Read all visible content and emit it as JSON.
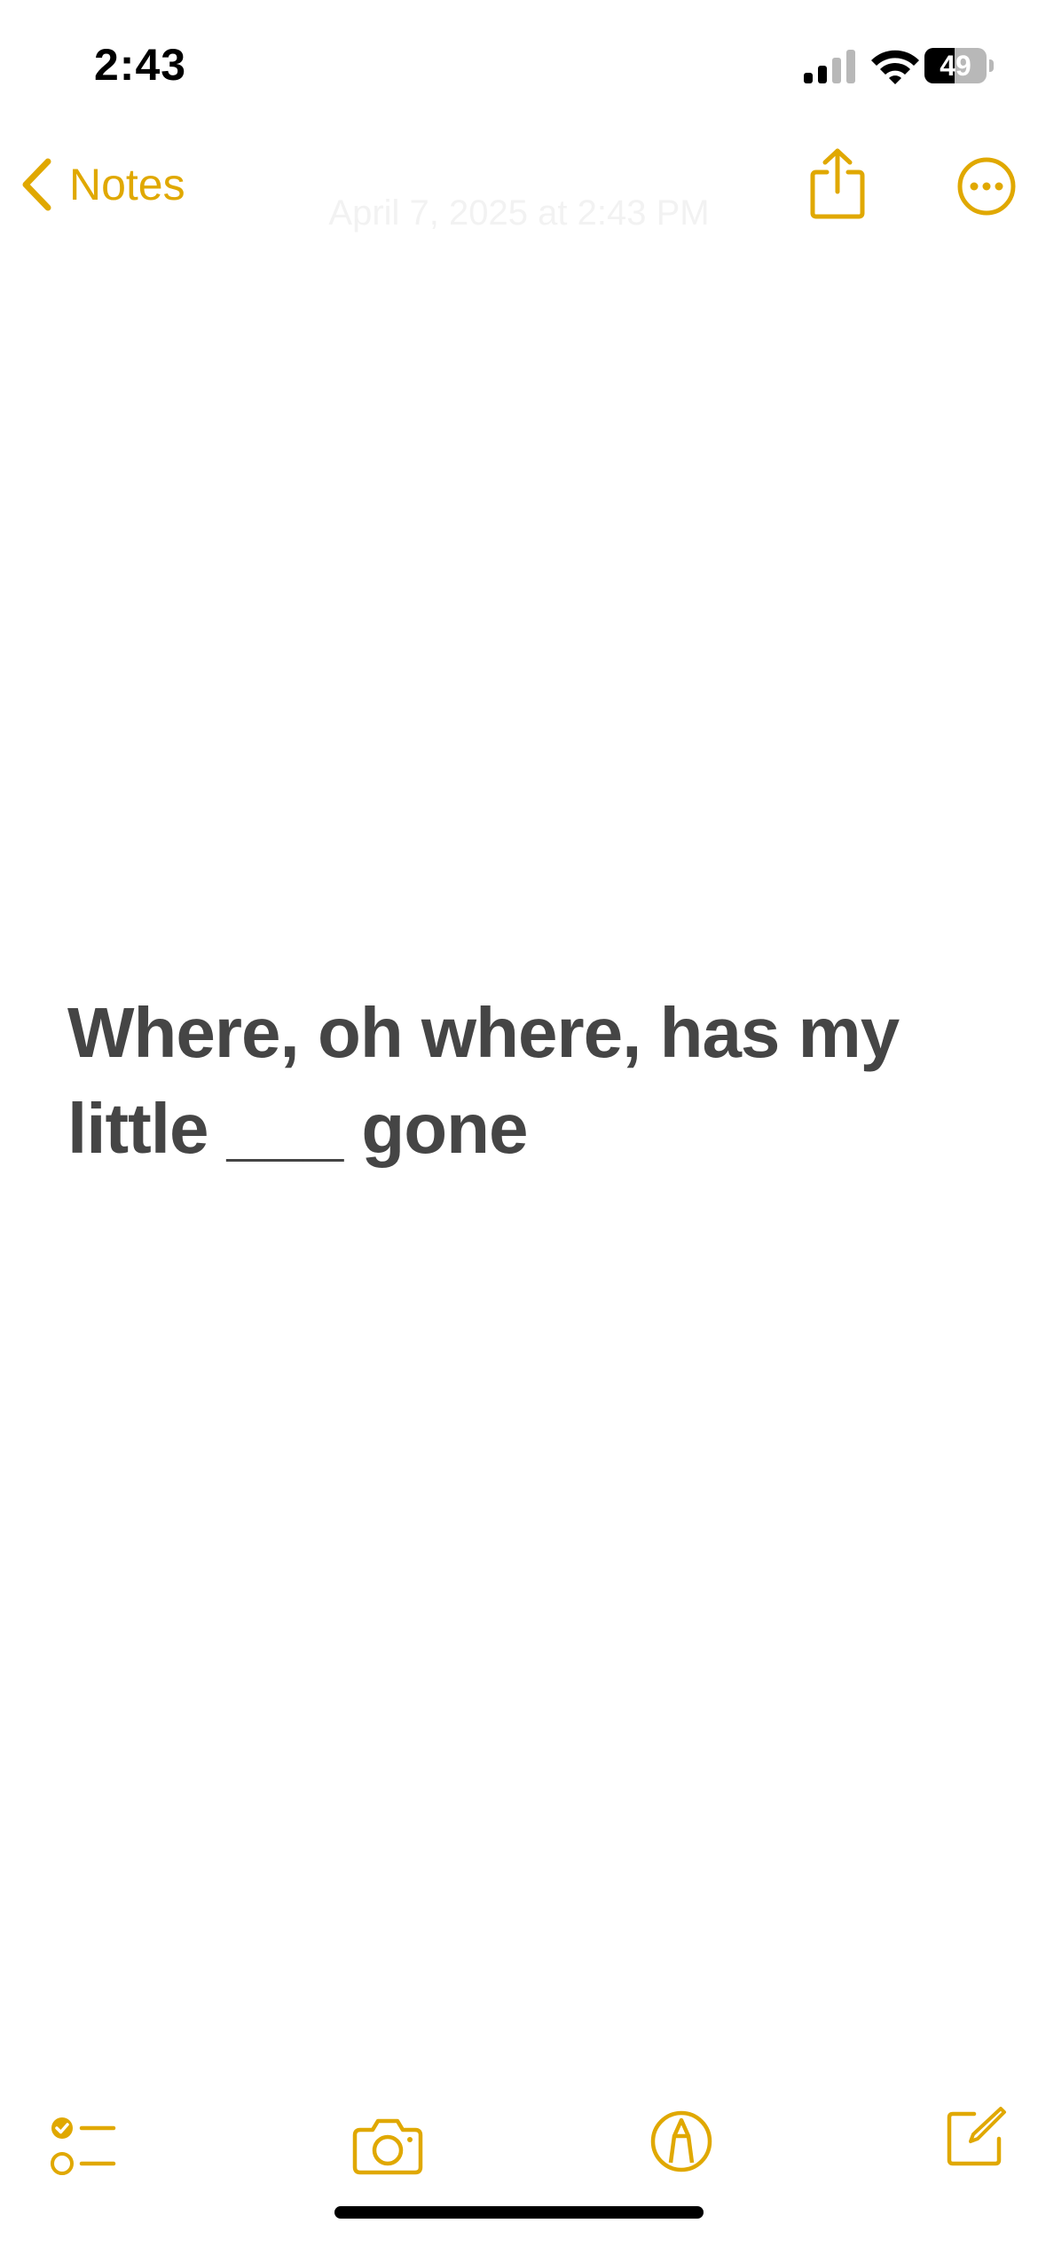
{
  "status_bar": {
    "time": "2:43",
    "battery_level": "49",
    "battery_fraction": 0.49
  },
  "nav": {
    "back_label": "Notes",
    "timestamp": "April 7, 2025 at 2:43 PM"
  },
  "note": {
    "text": "Where, oh where, has my little ___ gone"
  },
  "icons": {
    "back": "chevron-left-icon",
    "share": "share-icon",
    "more": "ellipsis-circle-icon",
    "checklist": "checklist-icon",
    "camera": "camera-icon",
    "markup": "markup-pen-icon",
    "compose": "compose-icon"
  },
  "colors": {
    "accent": "#e0a800",
    "note_text": "#454545",
    "timestamp": "#f2f2f2",
    "background": "#ffffff"
  }
}
